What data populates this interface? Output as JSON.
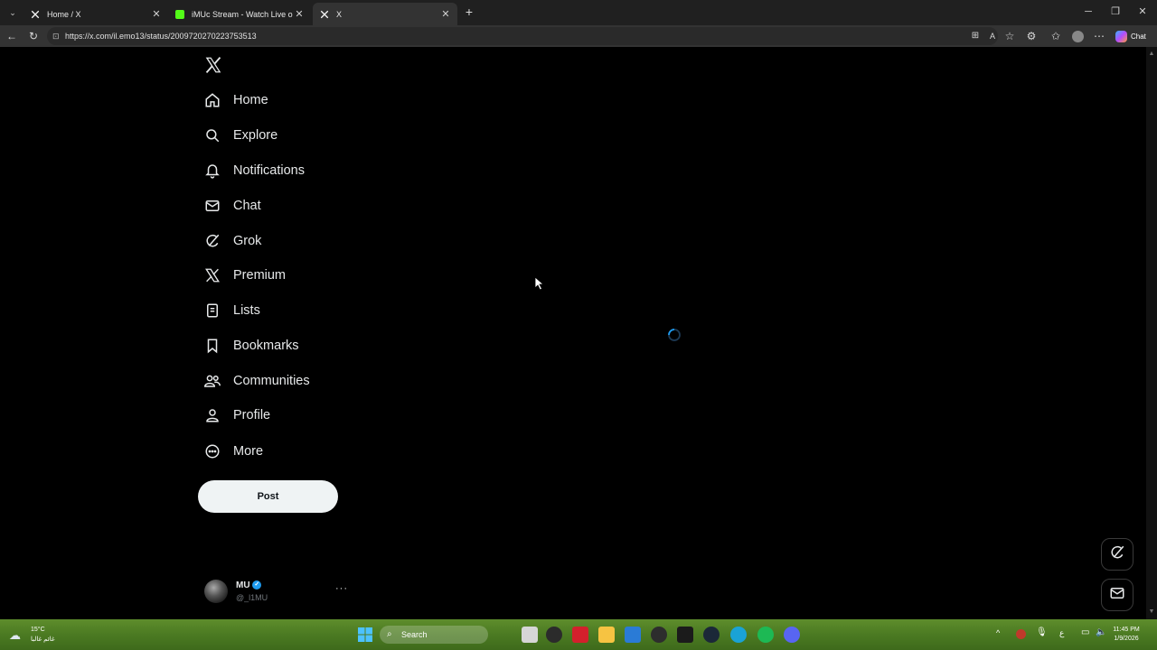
{
  "browser": {
    "tabs": [
      {
        "title": "Home / X",
        "icon": "x-logo-icon",
        "active": false
      },
      {
        "title": "iMUc Stream - Watch Live on Kick",
        "icon": "kick-logo-icon",
        "active": false
      },
      {
        "title": "X",
        "icon": "x-logo-icon",
        "active": true
      }
    ],
    "url": "https://x.com/il.emo13/status/2009720270223753513",
    "chat_label": "Chat"
  },
  "sidebar": {
    "items": [
      {
        "label": "Home",
        "icon": "home-icon"
      },
      {
        "label": "Explore",
        "icon": "search-icon"
      },
      {
        "label": "Notifications",
        "icon": "bell-icon"
      },
      {
        "label": "Chat",
        "icon": "mail-icon"
      },
      {
        "label": "Grok",
        "icon": "grok-icon"
      },
      {
        "label": "Premium",
        "icon": "x-logo-icon"
      },
      {
        "label": "Lists",
        "icon": "list-icon"
      },
      {
        "label": "Bookmarks",
        "icon": "bookmark-icon"
      },
      {
        "label": "Communities",
        "icon": "communities-icon"
      },
      {
        "label": "Profile",
        "icon": "person-icon"
      },
      {
        "label": "More",
        "icon": "more-circle-icon"
      }
    ],
    "post_label": "Post"
  },
  "account": {
    "name": "MU",
    "handle": "@_l1MU",
    "more": "···"
  },
  "taskbar": {
    "weather_temp": "15°C",
    "weather_desc": "غائم غالبا",
    "search_label": "Search",
    "time": "11:45 PM",
    "date": "1/9/2026",
    "lang": "ع"
  },
  "colors": {
    "page_bg": "#000000",
    "text": "#e7e9ea",
    "post_button_bg": "#eff3f4",
    "verified": "#1d9bf0"
  }
}
